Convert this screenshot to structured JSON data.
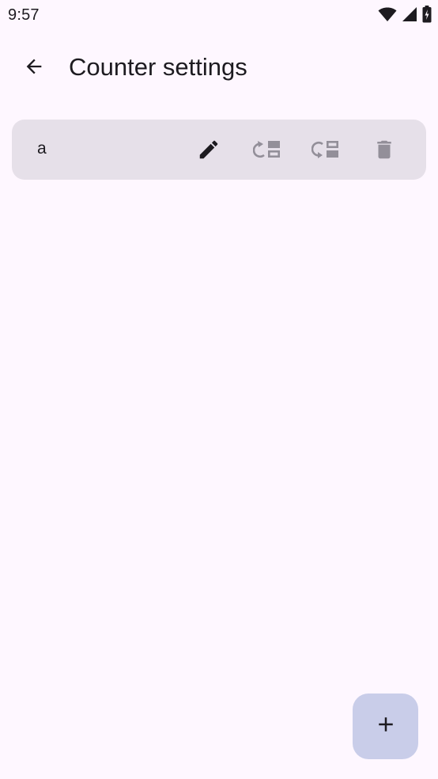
{
  "status_bar": {
    "time": "9:57",
    "icons": [
      "wifi-icon",
      "cellular-signal-icon",
      "battery-charging-icon"
    ]
  },
  "app_bar": {
    "back_icon": "arrow-back-icon",
    "title": "Counter settings"
  },
  "counters": [
    {
      "name": "a",
      "actions": [
        {
          "icon": "edit-icon",
          "enabled": true
        },
        {
          "icon": "move-up-icon",
          "enabled": false
        },
        {
          "icon": "move-down-icon",
          "enabled": false
        },
        {
          "icon": "delete-icon",
          "enabled": false
        }
      ]
    }
  ],
  "fab": {
    "icon": "add-icon"
  },
  "colors": {
    "background": "#fef7ff",
    "card": "#e6e0e9",
    "fab": "#c9cde9",
    "on_surface": "#1d1b20",
    "disabled_icon": "#938f99"
  }
}
